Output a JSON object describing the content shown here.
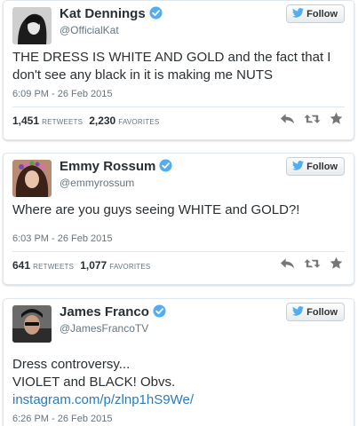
{
  "follow_label": "Follow",
  "tweets": [
    {
      "name": "Kat Dennings",
      "handle": "@OfficialKat",
      "text_lines": [
        "THE DRESS IS WHITE AND GOLD and the fact that I",
        "don't see any black in it is making me NUTS"
      ],
      "timestamp": "6:09 PM - 26 Feb 2015",
      "retweets": "1,451",
      "retweets_label": "RETWEETS",
      "favorites": "2,230",
      "favorites_label": "FAVORITES"
    },
    {
      "name": "Emmy Rossum",
      "handle": "@emmyrossum",
      "text_lines": [
        "Where are you guys seeing WHITE and GOLD?!"
      ],
      "timestamp": "6:03 PM - 26 Feb 2015",
      "retweets": "641",
      "retweets_label": "RETWEETS",
      "favorites": "1,077",
      "favorites_label": "FAVORITES"
    },
    {
      "name": "James Franco",
      "handle": "@JamesFrancoTV",
      "text_lines": [
        "Dress controversy...",
        "VIOLET and BLACK! Obvs."
      ],
      "link": "instagram.com/p/zlnp1hS9We/",
      "timestamp": "6:26 PM - 26 Feb 2015"
    }
  ],
  "icons": {
    "verified": "verified-badge-icon",
    "follow": "twitter-bird-icon",
    "reply": "reply-icon",
    "retweet": "retweet-icon",
    "favorite": "star-icon"
  },
  "colors": {
    "link": "#2b7bb9",
    "verified": "#55acee",
    "follow_bird": "#55acee",
    "action_icon": "#777777"
  }
}
